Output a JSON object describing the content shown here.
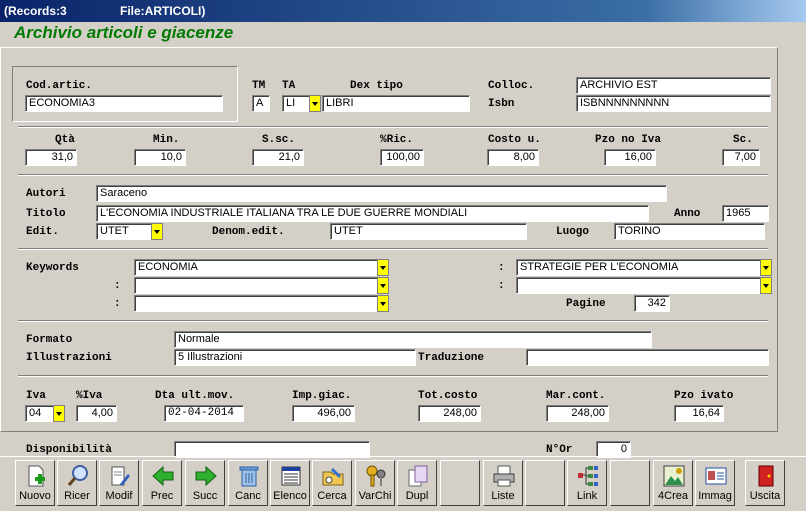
{
  "window": {
    "records": "(Records:3",
    "file": "File:ARTICOLI)"
  },
  "heading": "Archivio articoli e giacenze",
  "labels": {
    "cod_artic": "Cod.artic.",
    "tm": "TM",
    "ta": "TA",
    "dex_tipo": "Dex tipo",
    "colloc": "Colloc.",
    "isbn": "Isbn",
    "qta": "Qtà",
    "min": "Min.",
    "ssc": "S.sc.",
    "ric": "%Ric.",
    "costo_u": "Costo u.",
    "pzo_no_iva": "Pzo no Iva",
    "sc": "Sc.",
    "autori": "Autori",
    "titolo": "Titolo",
    "anno": "Anno",
    "edit": "Edit.",
    "denom_edit": "Denom.edit.",
    "luogo": "Luogo",
    "keywords": "Keywords",
    "colon": ":",
    "pagine": "Pagine",
    "formato": "Formato",
    "illustrazioni": "Illustrazioni",
    "traduzione": "Traduzione",
    "iva": "Iva",
    "perc_iva": "%Iva",
    "dta_ult_mov": "Dta ult.mov.",
    "imp_giac": "Imp.giac.",
    "tot_costo": "Tot.costo",
    "mar_cont": "Mar.cont.",
    "pzo_ivato": "Pzo ivato",
    "disponibilita": "Disponibilità",
    "n_or": "N°Or"
  },
  "values": {
    "cod_artic": "ECONOMIA3",
    "tm": "A",
    "ta": "LI",
    "dex_tipo": "LIBRI",
    "colloc": "ARCHIVIO EST",
    "isbn": "ISBNNNNNNNNN",
    "qta": "31,0",
    "min": "10,0",
    "ssc": "21,0",
    "ric": "100,00",
    "costo_u": "8,00",
    "pzo_no_iva": "16,00",
    "sc": "7,00",
    "autori": "Saraceno",
    "titolo": "L'ECONOMIA INDUSTRIALE ITALIANA TRA LE DUE GUERRE MONDIALI",
    "anno": "1965",
    "edit": "UTET",
    "denom_edit": "UTET",
    "luogo": "TORINO",
    "keyword1": "ECONOMIA",
    "keyword2": "",
    "keyword3": "",
    "keyword_r1": "STRATEGIE PER L'ECONOMIA",
    "keyword_r2": "",
    "pagine": "342",
    "formato": "Normale",
    "illustrazioni": "5 Illustrazioni",
    "traduzione": "",
    "iva": "04",
    "perc_iva": "4,00",
    "dta_ult_mov": "02-04-2014",
    "imp_giac": "496,00",
    "tot_costo": "248,00",
    "mar_cont": "248,00",
    "pzo_ivato": "16,64",
    "disponibilita": "",
    "n_or": "0"
  },
  "toolbar": [
    {
      "label": "Nuovo",
      "icon": "new-document-icon"
    },
    {
      "label": "Ricer",
      "icon": "magnifier-icon"
    },
    {
      "label": "Modif",
      "icon": "edit-document-icon"
    },
    {
      "label": "Prec",
      "icon": "arrow-left-icon"
    },
    {
      "label": "Succ",
      "icon": "arrow-right-icon"
    },
    {
      "label": "Canc",
      "icon": "trash-icon"
    },
    {
      "label": "Elenco",
      "icon": "list-icon"
    },
    {
      "label": "Cerca",
      "icon": "search-folder-icon"
    },
    {
      "label": "VarChi",
      "icon": "keys-icon"
    },
    {
      "label": "Dupl",
      "icon": "duplicate-icon"
    },
    {
      "label": "",
      "icon": ""
    },
    {
      "label": "Liste",
      "icon": "printer-icon"
    },
    {
      "label": "",
      "icon": ""
    },
    {
      "label": "Link",
      "icon": "link-tree-icon"
    },
    {
      "label": "",
      "icon": ""
    },
    {
      "label": "4Crea",
      "icon": "create-picture-icon"
    },
    {
      "label": "Immag",
      "icon": "image-card-icon"
    },
    {
      "label": "",
      "icon": ""
    },
    {
      "label": "Uscita",
      "icon": "exit-door-icon"
    }
  ],
  "colors": {
    "heading": "#007a00",
    "dropdown": "#ffff00",
    "titlebar": "#0a246a"
  }
}
